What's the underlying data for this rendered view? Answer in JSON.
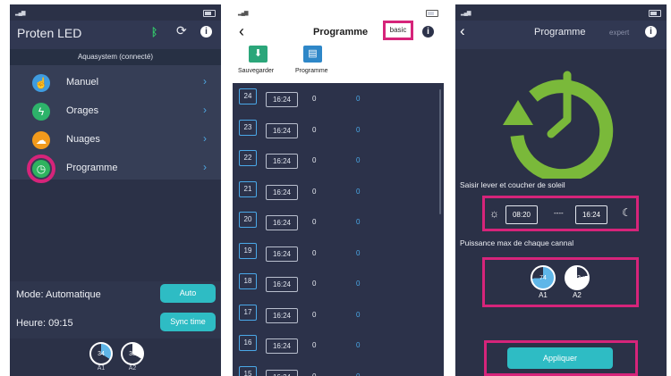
{
  "screen1": {
    "title": "Proten LED",
    "bluetooth_icon": "bluetooth-icon",
    "refresh_icon": "refresh-icon",
    "info_icon": "info-icon",
    "connection": "Aquasystem (connecté)",
    "menu": [
      {
        "label": "Manuel",
        "icon": "hand-icon",
        "color": "#3f9ce0"
      },
      {
        "label": "Orages",
        "icon": "lightning-icon",
        "color": "#2db36a"
      },
      {
        "label": "Nuages",
        "icon": "cloud-icon",
        "color": "#f29a1c"
      },
      {
        "label": "Programme",
        "icon": "clock-icon",
        "color": "#2fb35f",
        "highlighted": true
      }
    ],
    "mode_label": "Mode:",
    "mode_value": "Automatique",
    "mode_button": "Auto",
    "time_label": "Heure:",
    "time_value": "09:15",
    "sync_button": "Sync time",
    "channels": [
      {
        "name": "A1",
        "value": "34",
        "level": 0.34
      },
      {
        "name": "A2",
        "value": "33",
        "level": 0.33
      }
    ]
  },
  "screen2": {
    "title": "Programme",
    "mode_tab": "basic",
    "save_label": "Sauvegarder",
    "program_label": "Programme",
    "rows": [
      {
        "num": "24",
        "time": "16:24",
        "a": "0",
        "b": "0"
      },
      {
        "num": "23",
        "time": "16:24",
        "a": "0",
        "b": "0"
      },
      {
        "num": "22",
        "time": "16:24",
        "a": "0",
        "b": "0"
      },
      {
        "num": "21",
        "time": "16:24",
        "a": "0",
        "b": "0"
      },
      {
        "num": "20",
        "time": "16:24",
        "a": "0",
        "b": "0"
      },
      {
        "num": "19",
        "time": "16:24",
        "a": "0",
        "b": "0"
      },
      {
        "num": "18",
        "time": "16:24",
        "a": "0",
        "b": "0"
      },
      {
        "num": "17",
        "time": "16:24",
        "a": "0",
        "b": "0"
      },
      {
        "num": "16",
        "time": "16:24",
        "a": "0",
        "b": "0"
      },
      {
        "num": "15",
        "time": "16:24",
        "a": "0",
        "b": "0"
      }
    ]
  },
  "screen3": {
    "title": "Programme",
    "mode_tab": "expert",
    "sun_label": "Saisir lever et coucher de soleil",
    "sunrise": "08:20",
    "separator": "----",
    "sunset": "16:24",
    "power_label": "Puissance max de chaque cannal",
    "channels": [
      {
        "name": "A1",
        "value": "74",
        "level": 0.74
      },
      {
        "name": "A2",
        "value": "22",
        "level": 0.22
      }
    ],
    "apply_button": "Appliquer"
  },
  "colors": {
    "highlight": "#d6247a",
    "accent": "#2ebcc4",
    "link": "#4aa8e8",
    "clock_green": "#7ab93a"
  }
}
